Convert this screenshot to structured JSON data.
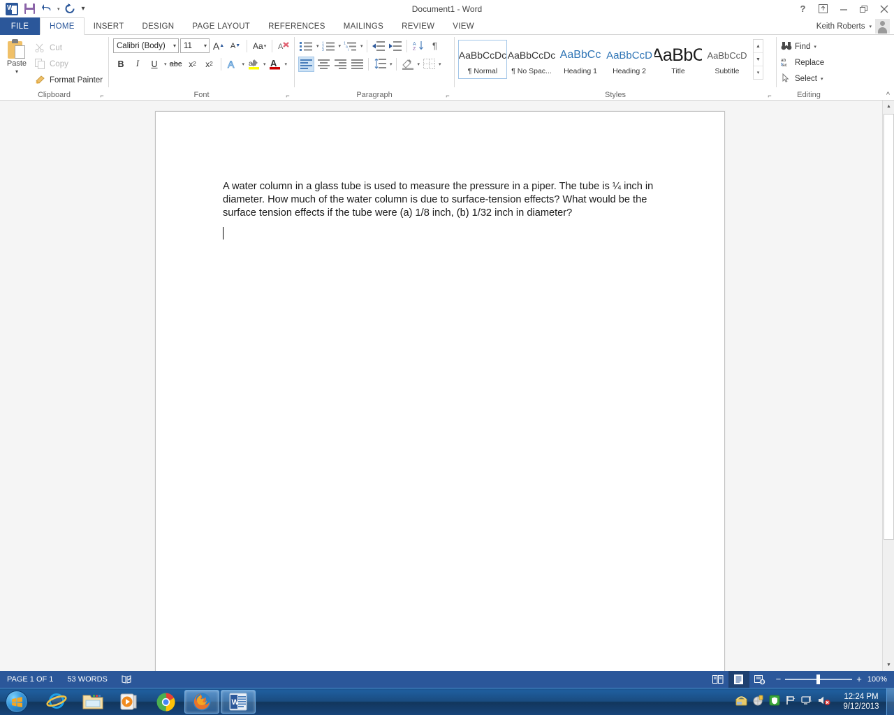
{
  "titlebar": {
    "document_title": "Document1 - Word",
    "qat": [
      {
        "name": "word-icon",
        "label": "Word"
      },
      {
        "name": "save-icon",
        "label": "Save"
      },
      {
        "name": "undo-icon",
        "label": "Undo"
      },
      {
        "name": "redo-icon",
        "label": "Repeat"
      },
      {
        "name": "customize-qat-icon",
        "label": "Customize Quick Access Toolbar"
      }
    ],
    "window_controls": [
      {
        "name": "help-button",
        "label": "?"
      },
      {
        "name": "ribbon-display-options-button",
        "label": "Ribbon Display Options"
      },
      {
        "name": "minimize-button",
        "label": "Minimize"
      },
      {
        "name": "restore-button",
        "label": "Restore Down"
      },
      {
        "name": "close-button",
        "label": "Close"
      }
    ]
  },
  "tabs": {
    "file_label": "FILE",
    "items": [
      "HOME",
      "INSERT",
      "DESIGN",
      "PAGE LAYOUT",
      "REFERENCES",
      "MAILINGS",
      "REVIEW",
      "VIEW"
    ],
    "active": "HOME"
  },
  "account": {
    "name": "Keith Roberts",
    "caret": "▾"
  },
  "ribbon": {
    "groups": [
      {
        "name": "Clipboard",
        "label": "Clipboard",
        "paste_label": "Paste",
        "items": [
          {
            "label": "Cut",
            "icon": "scissors-icon",
            "enabled": false
          },
          {
            "label": "Copy",
            "icon": "copy-icon",
            "enabled": false
          },
          {
            "label": "Format Painter",
            "icon": "format-painter-icon",
            "enabled": true
          }
        ]
      },
      {
        "name": "Font",
        "label": "Font",
        "font_name": "Calibri (Body)",
        "font_size": "11",
        "buttons_row1": [
          "Grow Font",
          "Shrink Font",
          "Change Case",
          "Clear All Formatting"
        ],
        "buttons_row2": [
          "Bold",
          "Italic",
          "Underline",
          "Strikethrough",
          "Subscript",
          "Superscript",
          "Text Effects and Typography",
          "Text Highlight Color",
          "Font Color"
        ]
      },
      {
        "name": "Paragraph",
        "label": "Paragraph",
        "buttons_row1": [
          "Bullets",
          "Numbering",
          "Multilevel List",
          "Decrease Indent",
          "Increase Indent",
          "Sort",
          "Show/Hide"
        ],
        "buttons_row2": [
          "Align Left",
          "Center",
          "Align Right",
          "Justify",
          "Line and Paragraph Spacing",
          "Shading",
          "Borders"
        ]
      },
      {
        "name": "Styles",
        "label": "Styles",
        "gallery": [
          {
            "preview": "AaBbCcDc",
            "name": "¶ Normal",
            "kind": "normal",
            "selected": true
          },
          {
            "preview": "AaBbCcDc",
            "name": "¶ No Spac...",
            "kind": "normal",
            "selected": false
          },
          {
            "preview": "AaBbCc",
            "name": "Heading 1",
            "kind": "h1",
            "selected": false
          },
          {
            "preview": "AaBbCcD",
            "name": "Heading 2",
            "kind": "h2",
            "selected": false
          },
          {
            "preview": "AaBbC",
            "name": "Title",
            "kind": "title",
            "selected": false
          },
          {
            "preview": "AaBbCcD",
            "name": "Subtitle",
            "kind": "sub",
            "selected": false
          }
        ]
      },
      {
        "name": "Editing",
        "label": "Editing",
        "items": [
          {
            "label": "Find",
            "icon": "binoculars-icon",
            "caret": true
          },
          {
            "label": "Replace",
            "icon": "replace-icon",
            "caret": false
          },
          {
            "label": "Select",
            "icon": "select-cursor-icon",
            "caret": true
          }
        ]
      }
    ],
    "collapse_label": "^"
  },
  "document": {
    "body_text": "A water column in a glass tube is used to measure the pressure in a piper. The tube is ¼ inch in diameter. How much of the water column is due to surface-tension effects? What would be the surface tension effects if the tube were (a) 1/8 inch, (b) 1/32 inch in diameter?"
  },
  "statusbar": {
    "page_label": "PAGE 1 OF 1",
    "word_count": "53 WORDS",
    "proofing_icon": "proofing-errors-icon",
    "views": [
      {
        "name": "read-mode-view-button",
        "active": false
      },
      {
        "name": "print-layout-view-button",
        "active": true
      },
      {
        "name": "web-layout-view-button",
        "active": false
      }
    ],
    "zoom_out": "−",
    "zoom_in": "+",
    "zoom_level": "100%"
  },
  "taskbar": {
    "start_label": "Start",
    "items": [
      {
        "name": "taskbar-internet-explorer",
        "label": "Internet Explorer",
        "running": false
      },
      {
        "name": "taskbar-file-explorer",
        "label": "File Explorer",
        "running": false
      },
      {
        "name": "taskbar-windows-media-player",
        "label": "Windows Media Player",
        "running": false
      },
      {
        "name": "taskbar-google-chrome",
        "label": "Google Chrome",
        "running": false
      },
      {
        "name": "taskbar-mozilla-firefox",
        "label": "Mozilla Firefox",
        "running": true
      },
      {
        "name": "taskbar-microsoft-word",
        "label": "Microsoft Word",
        "running": true
      }
    ],
    "tray_icons": [
      {
        "name": "tray-notification-icon"
      },
      {
        "name": "tray-security-icon"
      },
      {
        "name": "tray-shield-icon"
      },
      {
        "name": "tray-flag-icon"
      },
      {
        "name": "tray-network-icon"
      },
      {
        "name": "tray-volume-muted-icon"
      }
    ],
    "clock_time": "12:24 PM",
    "clock_date": "9/12/2013"
  },
  "colors": {
    "word_blue": "#2b579a",
    "accent_light": "#cde2f5",
    "heading_blue": "#2e74b5"
  }
}
